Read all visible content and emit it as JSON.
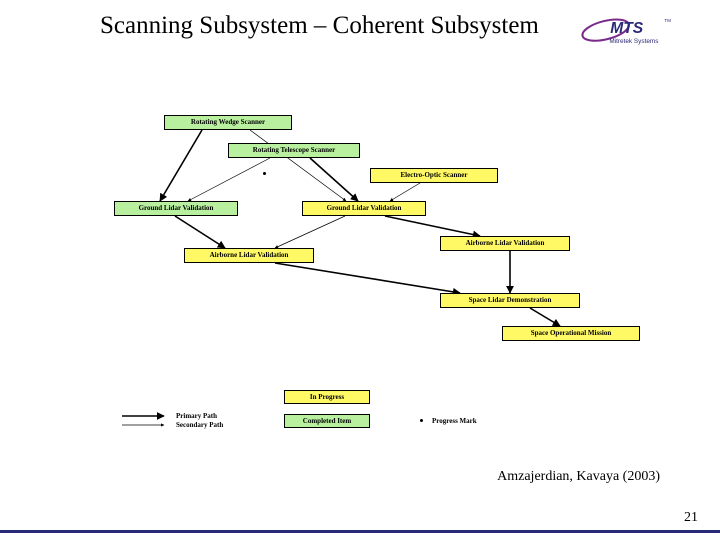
{
  "slide": {
    "title": "Scanning Subsystem – Coherent Subsystem",
    "citation": "Amzajerdian, Kavaya (2003)",
    "page_number": "21"
  },
  "logo": {
    "brand": "MTS",
    "tagline": "Mitretek Systems",
    "trademark": "TM"
  },
  "boxes": {
    "rotating_wedge": "Rotating Wedge Scanner",
    "rotating_telescope": "Rotating Telescope Scanner",
    "electro_optic": "Electro-Optic Scanner",
    "ground_lidar_1": "Ground Lidar Validation",
    "ground_lidar_2": "Ground Lidar Validation",
    "airborne_lidar_1": "Airborne Lidar Validation",
    "airborne_lidar_2": "Airborne Lidar Validation",
    "space_demo": "Space Lidar Demonstration",
    "space_mission": "Space Operational Mission"
  },
  "legend": {
    "primary_path": "Primary Path",
    "secondary_path": "Secondary Path",
    "in_progress": "In Progress",
    "completed": "Completed Item",
    "progress_mark": "Progress Mark"
  },
  "chart_data": {
    "type": "diagram",
    "title": "Scanning Subsystem – Coherent Subsystem",
    "nodes": [
      {
        "id": "rotating_wedge",
        "label": "Rotating Wedge Scanner",
        "status": "completed"
      },
      {
        "id": "rotating_telescope",
        "label": "Rotating Telescope Scanner",
        "status": "completed"
      },
      {
        "id": "electro_optic",
        "label": "Electro-Optic Scanner",
        "status": "in_progress"
      },
      {
        "id": "ground_lidar_1",
        "label": "Ground Lidar Validation",
        "status": "completed"
      },
      {
        "id": "ground_lidar_2",
        "label": "Ground Lidar Validation",
        "status": "in_progress"
      },
      {
        "id": "airborne_lidar_1",
        "label": "Airborne Lidar Validation",
        "status": "in_progress"
      },
      {
        "id": "airborne_lidar_2",
        "label": "Airborne Lidar Validation",
        "status": "in_progress"
      },
      {
        "id": "space_demo",
        "label": "Space Lidar Demonstration",
        "status": "in_progress"
      },
      {
        "id": "space_mission",
        "label": "Space Operational Mission",
        "status": "in_progress"
      }
    ],
    "edges": [
      {
        "from": "rotating_wedge",
        "to": "ground_lidar_1",
        "type": "primary"
      },
      {
        "from": "rotating_wedge",
        "to": "ground_lidar_2",
        "type": "secondary"
      },
      {
        "from": "rotating_telescope",
        "to": "ground_lidar_1",
        "type": "secondary"
      },
      {
        "from": "rotating_telescope",
        "to": "ground_lidar_2",
        "type": "primary"
      },
      {
        "from": "electro_optic",
        "to": "ground_lidar_2",
        "type": "secondary"
      },
      {
        "from": "ground_lidar_1",
        "to": "airborne_lidar_1",
        "type": "primary"
      },
      {
        "from": "ground_lidar_2",
        "to": "airborne_lidar_2",
        "type": "primary"
      },
      {
        "from": "ground_lidar_2",
        "to": "airborne_lidar_1",
        "type": "secondary"
      },
      {
        "from": "airborne_lidar_1",
        "to": "space_demo",
        "type": "primary"
      },
      {
        "from": "airborne_lidar_2",
        "to": "space_demo",
        "type": "primary"
      },
      {
        "from": "space_demo",
        "to": "space_mission",
        "type": "primary"
      }
    ],
    "progress_marks": [
      {
        "near": "rotating_telescope"
      }
    ],
    "legend": {
      "line_styles": {
        "primary": "solid-heavy",
        "secondary": "solid-light"
      },
      "status_colors": {
        "in_progress": "#fff966",
        "completed": "#b8f0a0"
      },
      "progress_mark": "black dot"
    }
  }
}
